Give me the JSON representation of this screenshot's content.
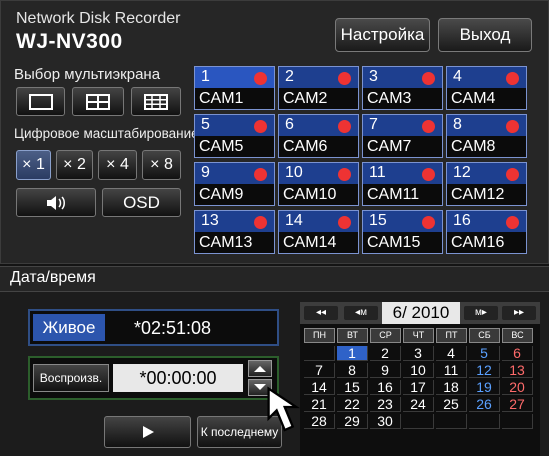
{
  "header": {
    "subtitle": "Network Disk Recorder",
    "model": "WJ-NV300",
    "settings_label": "Настройка",
    "exit_label": "Выход"
  },
  "multiscreen": {
    "label": "Выбор мультиэкрана",
    "layouts": [
      "single-view-icon",
      "quad-view-icon",
      "nine-view-icon"
    ]
  },
  "zoom": {
    "label": "Цифровое масштабирование",
    "options": [
      "× 1",
      "× 2",
      "× 4",
      "× 8"
    ],
    "selected": "× 1"
  },
  "audio": {
    "icon": "speaker-icon"
  },
  "osd": {
    "label": "OSD"
  },
  "cameras": [
    {
      "num": "1",
      "name": "CAM1"
    },
    {
      "num": "2",
      "name": "CAM2"
    },
    {
      "num": "3",
      "name": "CAM3"
    },
    {
      "num": "4",
      "name": "CAM4"
    },
    {
      "num": "5",
      "name": "CAM5"
    },
    {
      "num": "6",
      "name": "CAM6"
    },
    {
      "num": "7",
      "name": "CAM7"
    },
    {
      "num": "8",
      "name": "CAM8"
    },
    {
      "num": "9",
      "name": "CAM9"
    },
    {
      "num": "10",
      "name": "CAM10"
    },
    {
      "num": "11",
      "name": "CAM11"
    },
    {
      "num": "12",
      "name": "CAM12"
    },
    {
      "num": "13",
      "name": "CAM13"
    },
    {
      "num": "14",
      "name": "CAM14"
    },
    {
      "num": "15",
      "name": "CAM15"
    },
    {
      "num": "16",
      "name": "CAM16"
    }
  ],
  "datetime": {
    "title": "Дата/время",
    "live_label": "Живое",
    "live_time": "*02:51:08",
    "playback_label": "Воспроизв.",
    "playback_time": "*00:00:00",
    "play_icon": "play-icon",
    "last_label": "К последнему"
  },
  "calendar": {
    "nav_prev_year": "◂◂",
    "nav_prev_month": "◂м",
    "nav_next_month": "м▸",
    "nav_next_year": "▸▸",
    "month_year": "6/ 2010",
    "weekdays": [
      "ПН",
      "ВТ",
      "СР",
      "ЧТ",
      "ПТ",
      "СБ",
      "ВС"
    ],
    "selected_day": "1",
    "weeks": [
      [
        "",
        "1",
        "2",
        "3",
        "4",
        "5",
        "6"
      ],
      [
        "7",
        "8",
        "9",
        "10",
        "11",
        "12",
        "13"
      ],
      [
        "14",
        "15",
        "16",
        "17",
        "18",
        "19",
        "20"
      ],
      [
        "21",
        "22",
        "23",
        "24",
        "25",
        "26",
        "27"
      ],
      [
        "28",
        "29",
        "30",
        "",
        "",
        "",
        ""
      ]
    ],
    "colors": {
      "weekday": "#ffffff",
      "saturday": "#5aa0ff",
      "sunday": "#ff6b6b",
      "selected_bg": "#2f62c8"
    }
  }
}
